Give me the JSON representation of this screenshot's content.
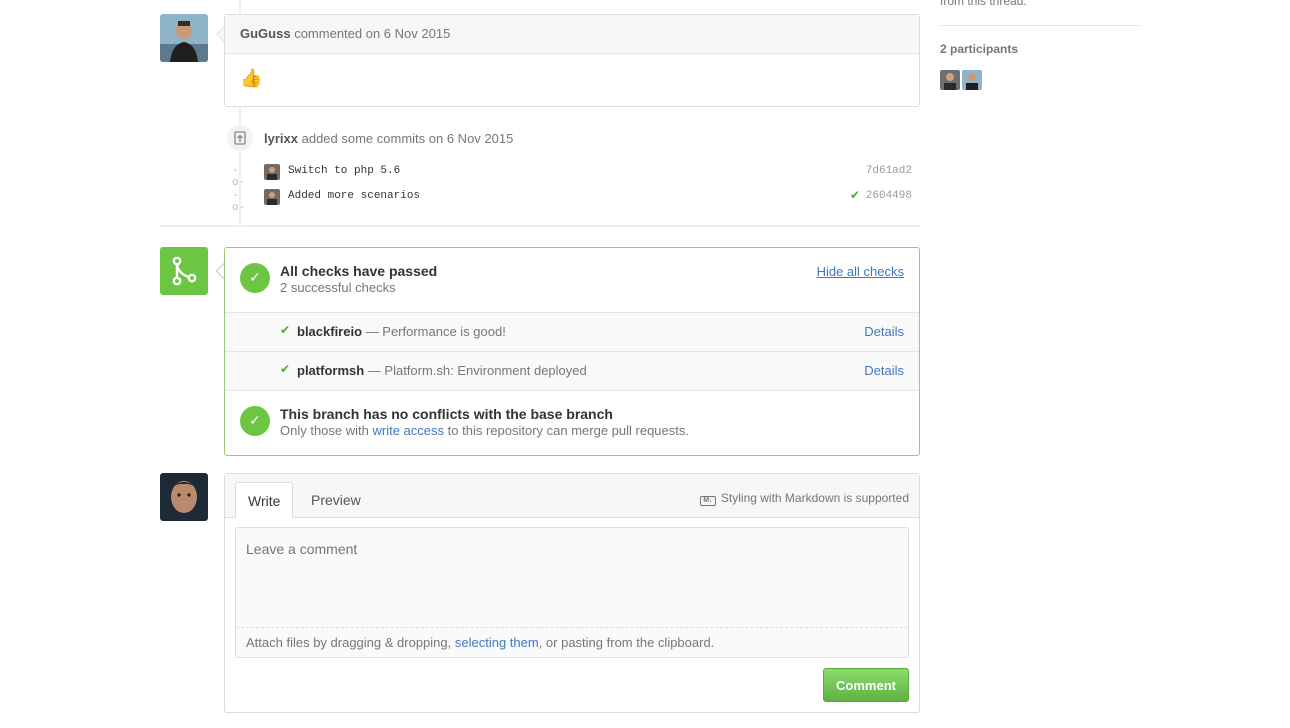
{
  "comment": {
    "author": "GuGuss",
    "meta": "commented on 6 Nov 2015",
    "reaction": "👍"
  },
  "commits_event": {
    "author": "lyrixx",
    "text": "added some commits on 6 Nov 2015",
    "commits": [
      {
        "message": "Switch to php 5.6",
        "sha": "7d61ad2",
        "status_ok": false
      },
      {
        "message": "Added more scenarios",
        "sha": "2604498",
        "status_ok": true
      }
    ]
  },
  "merge": {
    "checks_title": "All checks have passed",
    "checks_sub": "2 successful checks",
    "hide_link": "Hide all checks",
    "statuses": [
      {
        "context": "blackfireio",
        "description": "— Performance is good!",
        "details": "Details"
      },
      {
        "context": "platformsh",
        "description": "— Platform.sh: Environment deployed",
        "details": "Details"
      }
    ],
    "conflict_title": "This branch has no conflicts with the base branch",
    "conflict_pre": "Only those with",
    "conflict_link": "write access",
    "conflict_post": "to this repository can merge pull requests."
  },
  "form": {
    "tab_write": "Write",
    "tab_preview": "Preview",
    "markdown_note": "Styling with Markdown is supported",
    "placeholder": "Leave a comment",
    "attach_pre": "Attach files by dragging & dropping,",
    "attach_link": "selecting them",
    "attach_post": ", or pasting from the clipboard.",
    "submit": "Comment"
  },
  "sidebar": {
    "top_text": "from this thread.",
    "participants_heading": "2 participants"
  },
  "colors": {
    "success": "#6cc644",
    "link": "#4078c0",
    "button_green": "#60b044"
  }
}
